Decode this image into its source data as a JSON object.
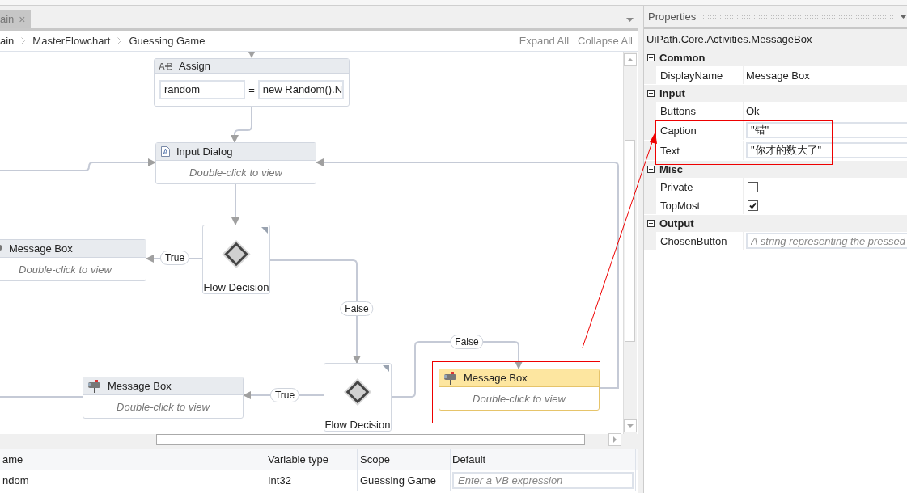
{
  "tabs": [
    {
      "label": "ain",
      "selected": true,
      "close": "×"
    }
  ],
  "breadcrumb": [
    "ain",
    "MasterFlowchart",
    "Guessing Game"
  ],
  "designer_actions": [
    "Expand All",
    "Collapse All"
  ],
  "flowchart": {
    "nodes": [
      {
        "kind": "assign",
        "title": "Assign",
        "to": "random",
        "op": "=",
        "value": "new Random().N",
        "selected": false
      },
      {
        "kind": "input",
        "title": "Input Dialog",
        "hint": "Double-click to view",
        "selected": false
      },
      {
        "kind": "decision",
        "title": "Flow Decision",
        "selected": false
      },
      {
        "kind": "message",
        "title": "Message Box",
        "hint": "Double-click to view",
        "selected": false
      },
      {
        "kind": "decision",
        "title": "Flow Decision",
        "selected": false
      },
      {
        "kind": "message",
        "title": "Message Box",
        "hint": "Double-click to view",
        "selected": false
      },
      {
        "kind": "message",
        "title": "Message Box",
        "hint": "Double-click to view",
        "selected": true
      }
    ],
    "edge_labels": [
      "True",
      "False",
      "True",
      "False"
    ]
  },
  "variables": {
    "columns": [
      "ame",
      "Variable type",
      "Scope",
      "Default"
    ],
    "rows": [
      {
        "cells": [
          "ndom",
          "Int32",
          "Guessing Game"
        ],
        "default_placeholder": "Enter a VB expression"
      }
    ]
  },
  "properties": {
    "title": "Properties",
    "type_name": "UiPath.Core.Activities.MessageBox",
    "categories": [
      {
        "name": "Common",
        "expanded": true,
        "rows": [
          {
            "kind": "text",
            "name": "DisplayName",
            "value": "Message Box"
          }
        ]
      },
      {
        "name": "Input",
        "expanded": true,
        "rows": [
          {
            "kind": "text",
            "name": "Buttons",
            "value": "Ok"
          },
          {
            "kind": "field",
            "name": "Caption",
            "value": "\"错\""
          },
          {
            "kind": "field",
            "name": "Text",
            "value": "\"你才的数大了\""
          }
        ]
      },
      {
        "name": "Misc",
        "expanded": true,
        "rows": [
          {
            "kind": "checkbox",
            "name": "Private",
            "checked": false
          },
          {
            "kind": "checkbox",
            "name": "TopMost",
            "checked": true
          }
        ]
      },
      {
        "name": "Output",
        "expanded": true,
        "rows": [
          {
            "kind": "placeholder",
            "name": "ChosenButton",
            "placeholder": "A string representing the pressed"
          }
        ]
      }
    ]
  }
}
